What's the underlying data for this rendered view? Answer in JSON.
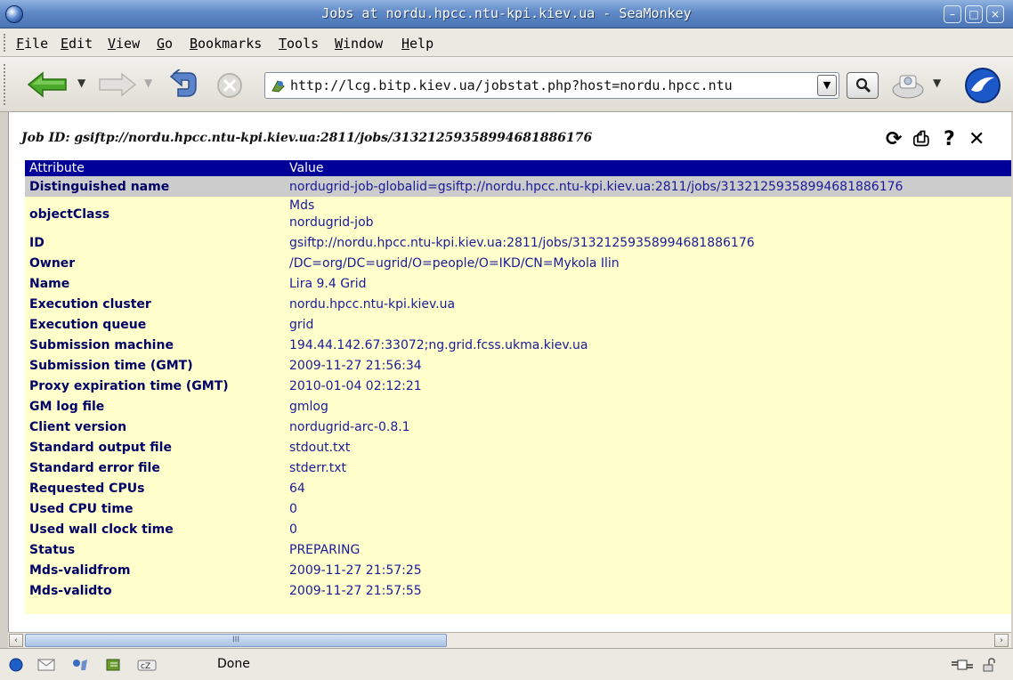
{
  "window": {
    "title": "Jobs at nordu.hpcc.ntu-kpi.kiev.ua - SeaMonkey"
  },
  "menu": {
    "items": [
      {
        "key": "F",
        "rest": "ile"
      },
      {
        "key": "E",
        "rest": "dit"
      },
      {
        "key": "V",
        "rest": "iew"
      },
      {
        "key": "G",
        "rest": "o"
      },
      {
        "key": "B",
        "rest": "ookmarks"
      },
      {
        "key": "T",
        "rest": "ools"
      },
      {
        "key": "W",
        "rest": "indow"
      },
      {
        "key": "H",
        "rest": "elp"
      }
    ]
  },
  "nav": {
    "url": "http://lcg.bitp.kiev.ua/jobstat.php?host=nordu.hpcc.ntu"
  },
  "page": {
    "job_header": "Job ID: gsiftp://nordu.hpcc.ntu-kpi.kiev.ua:2811/jobs/31321259358994681886176",
    "tools": {
      "refresh": "⟳",
      "print": "⎙",
      "help": "?",
      "close": "✕"
    },
    "table": {
      "headers": [
        "Attribute",
        "Value"
      ],
      "dn_label": "Distinguished name",
      "dn_value": "nordugrid-job-globalid=gsiftp://nordu.hpcc.ntu-kpi.kiev.ua:2811/jobs/31321259358994681886176",
      "oc_label": "objectClass",
      "oc_value_1": "Mds",
      "oc_value_2": "nordugrid-job",
      "rows": [
        {
          "attr": "ID",
          "value": "gsiftp://nordu.hpcc.ntu-kpi.kiev.ua:2811/jobs/31321259358994681886176"
        },
        {
          "attr": "Owner",
          "value": "/DC=org/DC=ugrid/O=people/O=IKD/CN=Mykola Ilin"
        },
        {
          "attr": "Name",
          "value": "Lira 9.4 Grid"
        },
        {
          "attr": "Execution cluster",
          "value": "nordu.hpcc.ntu-kpi.kiev.ua"
        },
        {
          "attr": "Execution queue",
          "value": "grid"
        },
        {
          "attr": "Submission machine",
          "value": "194.44.142.67:33072;ng.grid.fcss.ukma.kiev.ua"
        },
        {
          "attr": "Submission time (GMT)",
          "value": "2009-11-27 21:56:34"
        },
        {
          "attr": "Proxy expiration time (GMT)",
          "value": "2010-01-04 02:12:21"
        },
        {
          "attr": "GM log file",
          "value": "gmlog"
        },
        {
          "attr": "Client version",
          "value": "nordugrid-arc-0.8.1"
        },
        {
          "attr": "Standard output file",
          "value": "stdout.txt"
        },
        {
          "attr": "Standard error file",
          "value": "stderr.txt"
        },
        {
          "attr": "Requested CPUs",
          "value": "64"
        },
        {
          "attr": "Used CPU time",
          "value": "0"
        },
        {
          "attr": "Used wall clock time",
          "value": "0"
        },
        {
          "attr": "Status",
          "value": "PREPARING"
        },
        {
          "attr": "Mds-validfrom",
          "value": "2009-11-27 21:57:25"
        },
        {
          "attr": "Mds-validto",
          "value": "2009-11-27 21:57:55"
        }
      ]
    }
  },
  "scrollbar": {
    "thumb_grip": "III"
  },
  "status": {
    "text": "Done"
  },
  "colors": {
    "table_header_bg": "#000099",
    "table_bg": "#ffffcc",
    "highlight_row_bg": "#cccccc",
    "attr_text": "#000066"
  }
}
